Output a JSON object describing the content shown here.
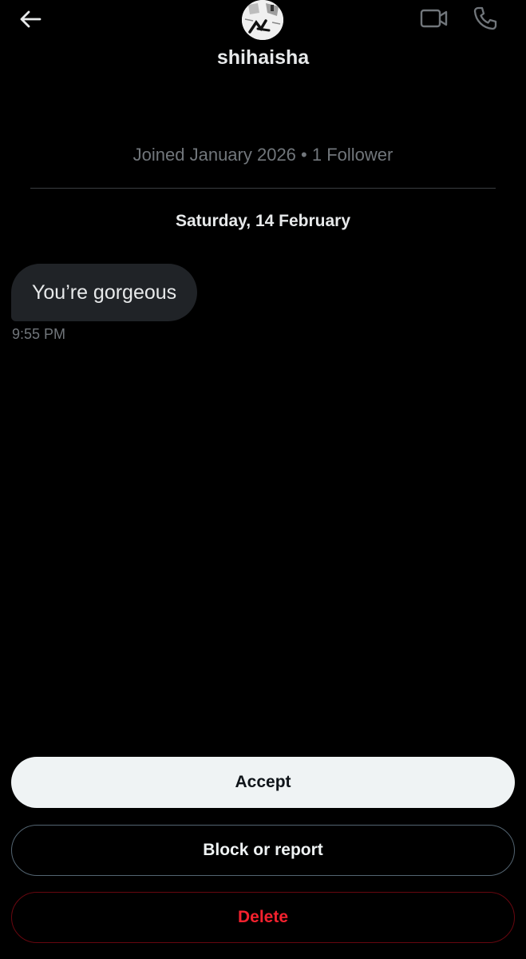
{
  "header": {
    "display_name": "shihaisha",
    "back_icon": "arrow-left-icon",
    "video_icon": "video-camera-icon",
    "call_icon": "phone-icon"
  },
  "profile": {
    "meta": "Joined January 2026 • 1 Follower"
  },
  "conversation": {
    "date_header": "Saturday, 14 February",
    "messages": [
      {
        "text": "You’re gorgeous",
        "time": "9:55 PM"
      }
    ]
  },
  "actions": {
    "accept_label": "Accept",
    "block_label": "Block or report",
    "delete_label": "Delete"
  },
  "colors": {
    "background": "#000000",
    "bubble": "#202327",
    "muted_text": "#71767b",
    "accept_bg": "#eff3f4",
    "delete_red": "#f4212e"
  }
}
